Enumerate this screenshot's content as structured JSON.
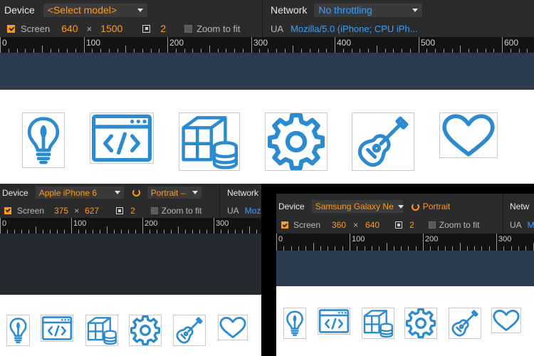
{
  "accent": "#2a8bd0",
  "top": {
    "device_label": "Device",
    "device_value": "<Select model>",
    "network_label": "Network",
    "network_value": "No throttling",
    "screen_label": "Screen",
    "width": "640",
    "times": "×",
    "height": "1500",
    "dpr": "2",
    "zoom_label": "Zoom to fit",
    "ua_label": "UA",
    "ua_value": "Mozilla/5.0 (iPhone; CPU iPh...",
    "ruler_ticks": [
      "0",
      "100",
      "200",
      "300",
      "400",
      "500",
      "600"
    ]
  },
  "left": {
    "device_label": "Device",
    "device_value": "Apple iPhone 6",
    "orientation": "Portrait –",
    "network_label": "Network",
    "screen_label": "Screen",
    "width": "375",
    "times": "×",
    "height": "627",
    "dpr": "2",
    "zoom_label": "Zoom to fit",
    "ua_label": "UA",
    "ua_value": "Moz",
    "ruler_ticks": [
      "0",
      "100",
      "200",
      "300"
    ]
  },
  "right": {
    "device_label": "Device",
    "device_value": "Samsung Galaxy Ne",
    "orientation": "Portrait",
    "network_label": "Netw",
    "screen_label": "Screen",
    "width": "360",
    "times": "×",
    "height": "640",
    "dpr": "2",
    "zoom_label": "Zoom to fit",
    "ua_label": "UA",
    "ua_value": "M",
    "ruler_ticks": [
      "0",
      "100",
      "200",
      "300"
    ]
  },
  "icons": [
    "lightbulb-icon",
    "code-window-icon",
    "box-database-icon",
    "gear-icon",
    "guitar-icon",
    "heart-icon"
  ]
}
